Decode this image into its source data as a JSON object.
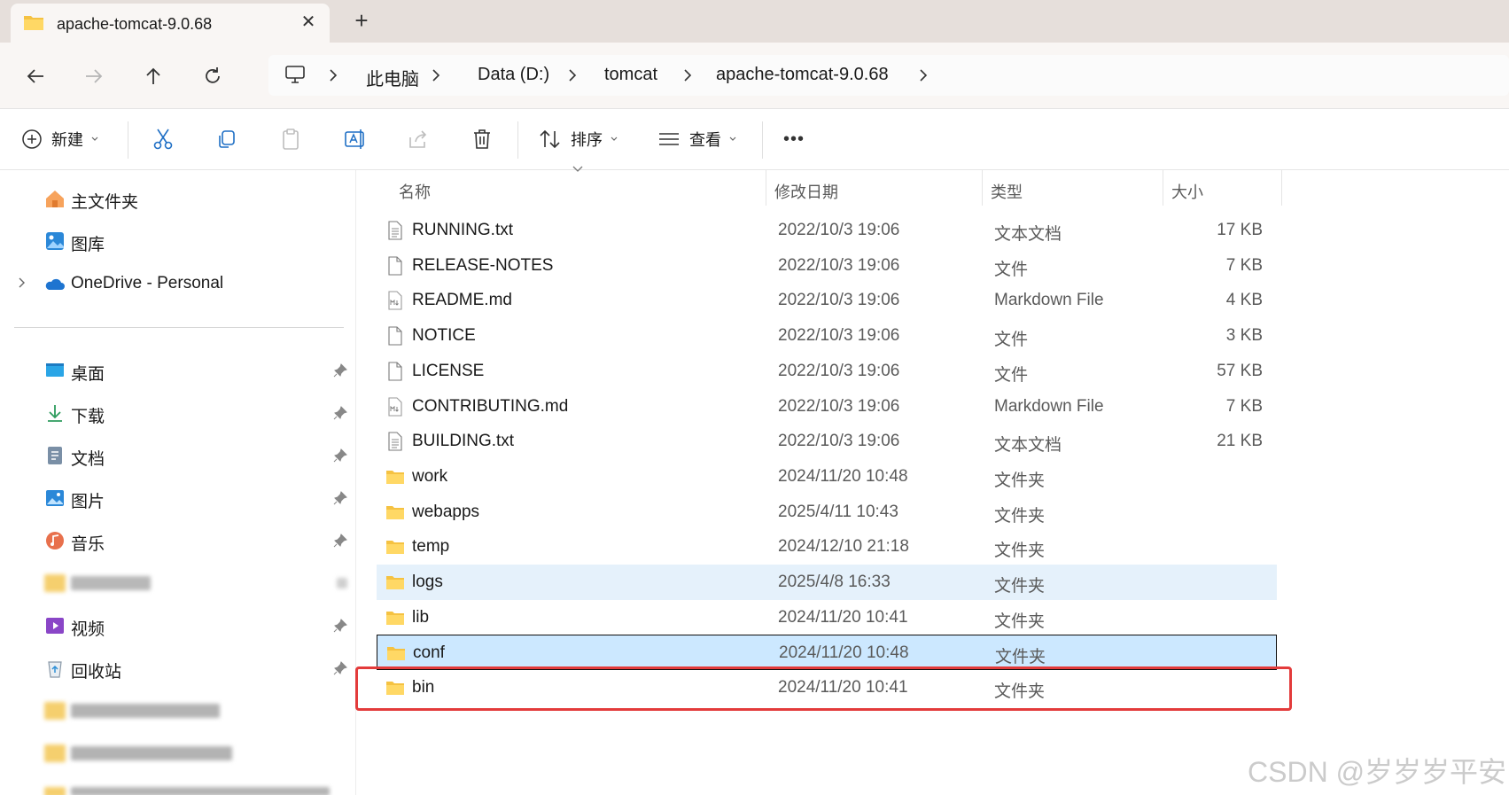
{
  "tab": {
    "title": "apache-tomcat-9.0.68",
    "close": "✕",
    "new_tab": "+"
  },
  "breadcrumb": [
    "此电脑",
    "Data (D:)",
    "tomcat",
    "apache-tomcat-9.0.68"
  ],
  "commands": {
    "new": "新建",
    "sort": "排序",
    "view": "查看",
    "more": "•••"
  },
  "sidebar": {
    "top": [
      {
        "label": "主文件夹",
        "icon": "home-icon"
      },
      {
        "label": "图库",
        "icon": "gallery-icon"
      },
      {
        "label": "OneDrive - Personal",
        "icon": "onedrive-icon"
      }
    ],
    "quick": [
      {
        "label": "桌面",
        "icon": "desktop-icon"
      },
      {
        "label": "下载",
        "icon": "download-icon"
      },
      {
        "label": "文档",
        "icon": "documents-icon"
      },
      {
        "label": "图片",
        "icon": "pictures-icon"
      },
      {
        "label": "音乐",
        "icon": "music-icon"
      },
      {
        "label": "视频",
        "icon": "videos-icon"
      },
      {
        "label": "回收站",
        "icon": "recycle-bin-icon"
      }
    ]
  },
  "columns": {
    "name": "名称",
    "date": "修改日期",
    "type": "类型",
    "size": "大小"
  },
  "files": [
    {
      "name": "RUNNING.txt",
      "date": "2022/10/3 19:06",
      "type": "文本文档",
      "size": "17 KB",
      "icon": "text-file-icon"
    },
    {
      "name": "RELEASE-NOTES",
      "date": "2022/10/3 19:06",
      "type": "文件",
      "size": "7 KB",
      "icon": "file-icon"
    },
    {
      "name": "README.md",
      "date": "2022/10/3 19:06",
      "type": "Markdown File",
      "size": "4 KB",
      "icon": "markdown-file-icon"
    },
    {
      "name": "NOTICE",
      "date": "2022/10/3 19:06",
      "type": "文件",
      "size": "3 KB",
      "icon": "file-icon"
    },
    {
      "name": "LICENSE",
      "date": "2022/10/3 19:06",
      "type": "文件",
      "size": "57 KB",
      "icon": "file-icon"
    },
    {
      "name": "CONTRIBUTING.md",
      "date": "2022/10/3 19:06",
      "type": "Markdown File",
      "size": "7 KB",
      "icon": "markdown-file-icon"
    },
    {
      "name": "BUILDING.txt",
      "date": "2022/10/3 19:06",
      "type": "文本文档",
      "size": "21 KB",
      "icon": "text-file-icon"
    },
    {
      "name": "work",
      "date": "2024/11/20 10:48",
      "type": "文件夹",
      "size": "",
      "icon": "folder-icon"
    },
    {
      "name": "webapps",
      "date": "2025/4/11 10:43",
      "type": "文件夹",
      "size": "",
      "icon": "folder-icon"
    },
    {
      "name": "temp",
      "date": "2024/12/10 21:18",
      "type": "文件夹",
      "size": "",
      "icon": "folder-icon"
    },
    {
      "name": "logs",
      "date": "2025/4/8 16:33",
      "type": "文件夹",
      "size": "",
      "icon": "folder-icon"
    },
    {
      "name": "lib",
      "date": "2024/11/20 10:41",
      "type": "文件夹",
      "size": "",
      "icon": "folder-icon"
    },
    {
      "name": "conf",
      "date": "2024/11/20 10:48",
      "type": "文件夹",
      "size": "",
      "icon": "folder-icon"
    },
    {
      "name": "bin",
      "date": "2024/11/20 10:41",
      "type": "文件夹",
      "size": "",
      "icon": "folder-icon"
    }
  ],
  "watermark": "CSDN @岁岁岁平安",
  "colors": {
    "selected_row": "#cce8ff",
    "hover_row": "#e5f1fb",
    "annotation": "#e33b3b",
    "folder": "#f5c242"
  }
}
